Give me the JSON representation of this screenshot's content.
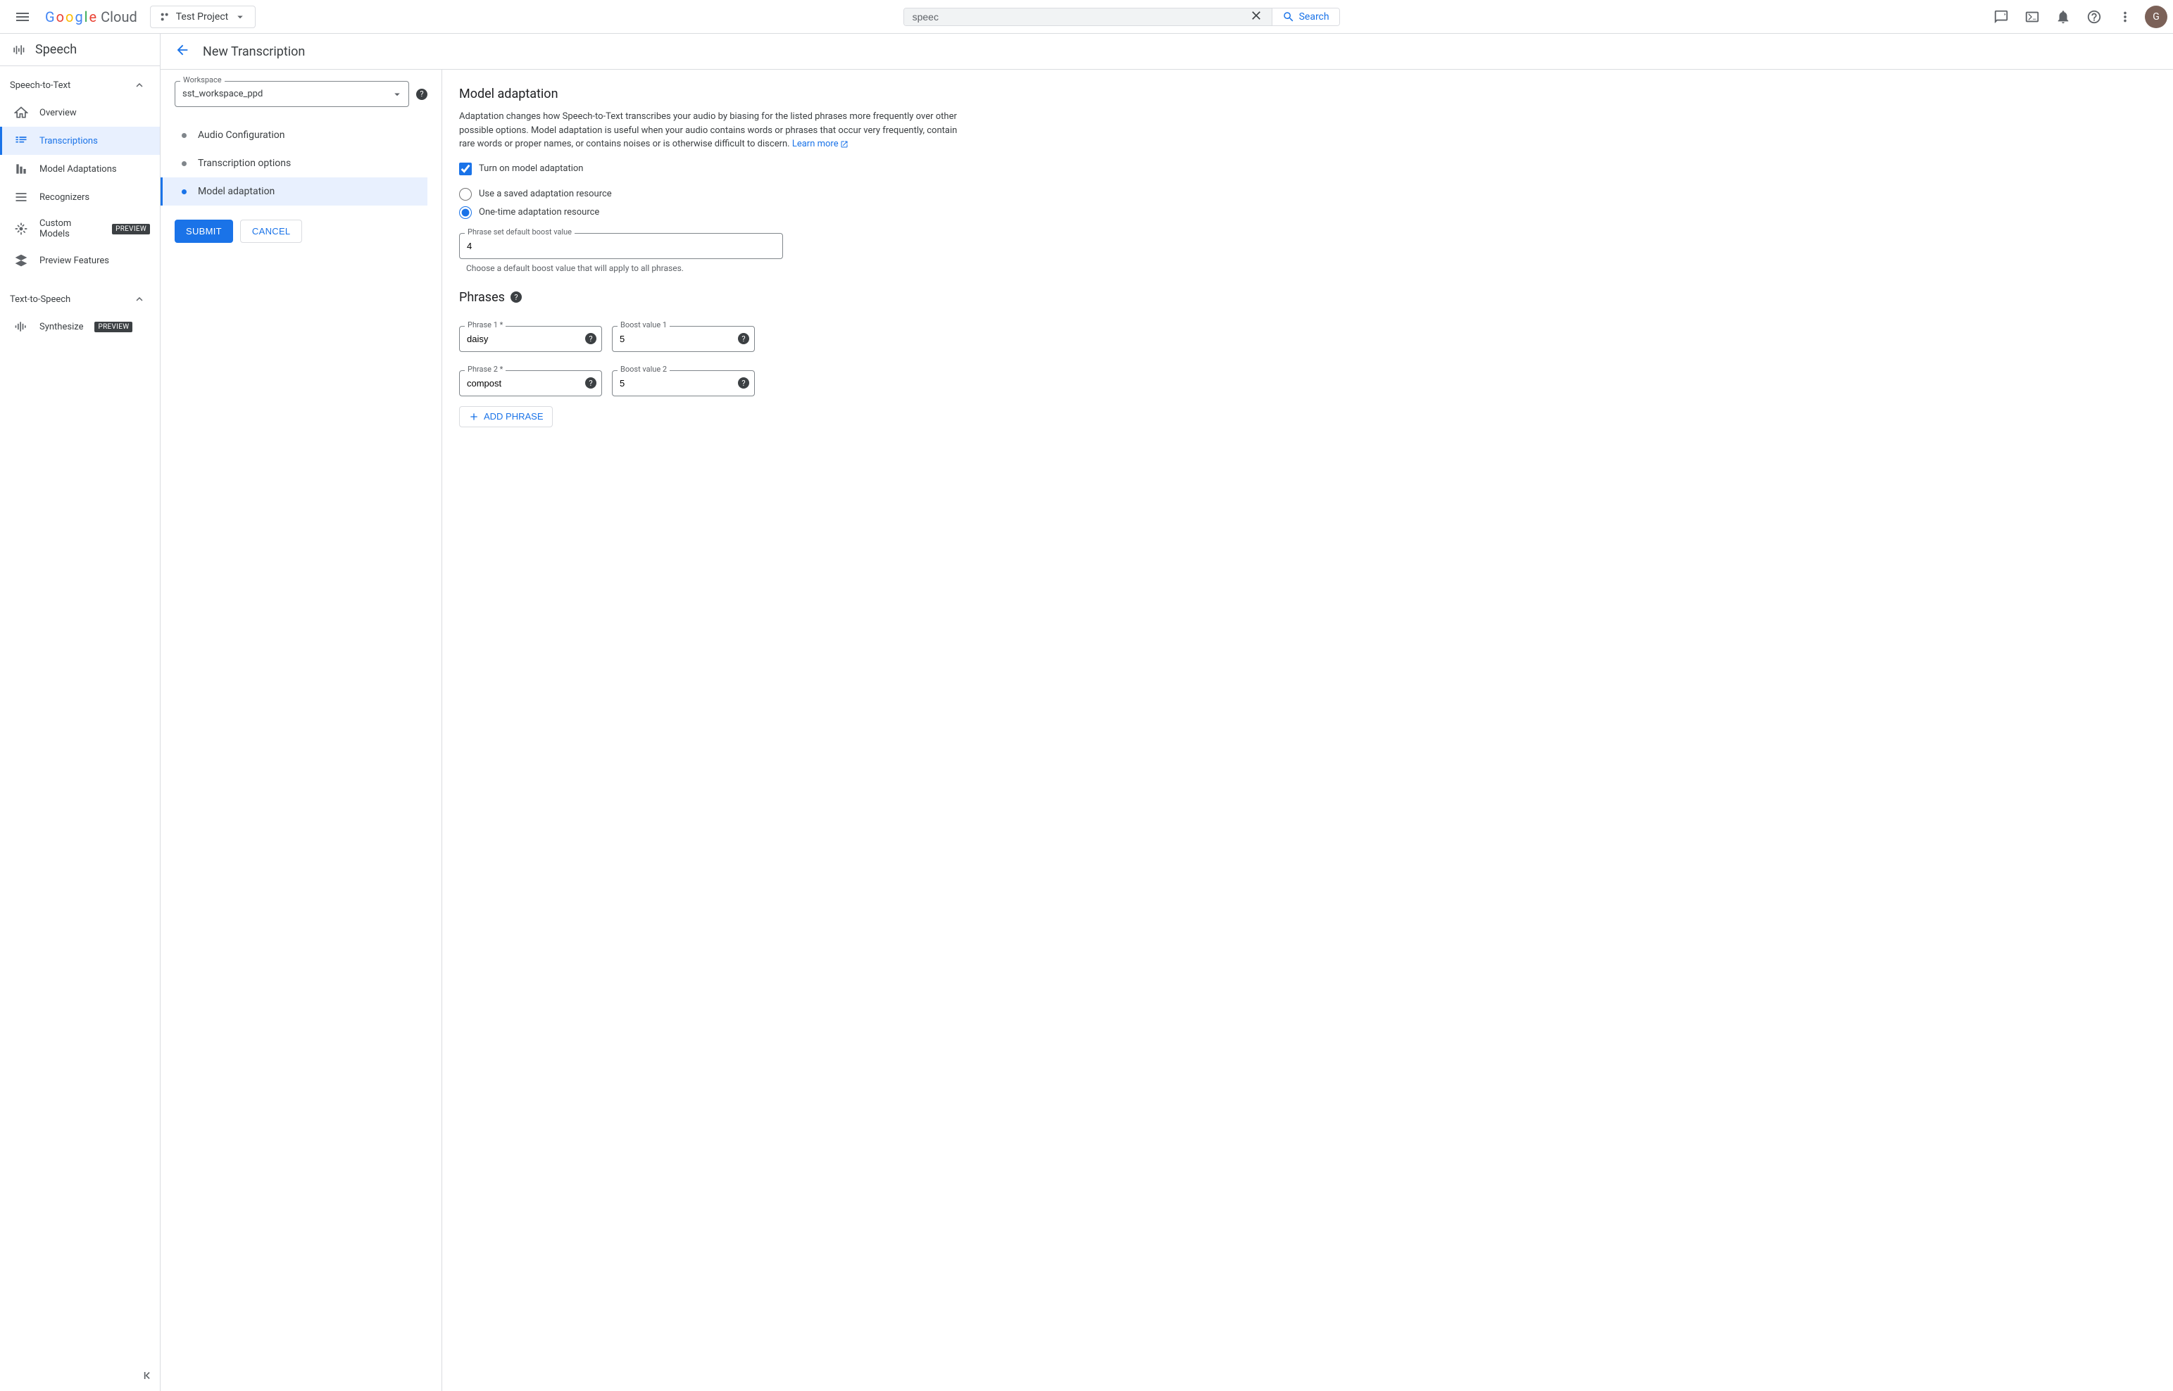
{
  "header": {
    "logo_cloud": "Cloud",
    "project": "Test Project",
    "search_value": "speec",
    "search_button": "Search",
    "avatar_initial": "G"
  },
  "sidebar": {
    "product": "Speech",
    "sections": [
      {
        "title": "Speech-to-Text",
        "items": [
          {
            "label": "Overview"
          },
          {
            "label": "Transcriptions"
          },
          {
            "label": "Model Adaptations"
          },
          {
            "label": "Recognizers"
          },
          {
            "label": "Custom Models",
            "badge": "PREVIEW"
          },
          {
            "label": "Preview Features"
          }
        ]
      },
      {
        "title": "Text-to-Speech",
        "items": [
          {
            "label": "Synthesize",
            "badge": "PREVIEW"
          }
        ]
      }
    ]
  },
  "page": {
    "title": "New Transcription",
    "workspace_label": "Workspace",
    "workspace_value": "sst_workspace_ppd",
    "steps": [
      "Audio Configuration",
      "Transcription options",
      "Model adaptation"
    ],
    "submit": "SUBMIT",
    "cancel": "CANCEL"
  },
  "form": {
    "heading": "Model adaptation",
    "description": "Adaptation changes how Speech-to-Text transcribes your audio by biasing for the listed phrases more frequently over other possible options. Model adaptation is useful when your audio contains words or phrases that occur very frequently, contain rare words or proper names, or contains noises or is otherwise difficult to discern. ",
    "learn_more": "Learn more",
    "toggle_label": "Turn on model adaptation",
    "radio_saved": "Use a saved adaptation resource",
    "radio_onetime": "One-time adaptation resource",
    "boost_label": "Phrase set default boost value",
    "boost_value": "4",
    "boost_helper": "Choose a default boost value that will apply to all phrases.",
    "phrases_heading": "Phrases",
    "phrases": [
      {
        "phrase_label": "Phrase 1 *",
        "phrase_value": "daisy",
        "boost_label": "Boost value 1",
        "boost_value": "5"
      },
      {
        "phrase_label": "Phrase 2 *",
        "phrase_value": "compost",
        "boost_label": "Boost value 2",
        "boost_value": "5"
      }
    ],
    "add_phrase": "ADD PHRASE"
  }
}
